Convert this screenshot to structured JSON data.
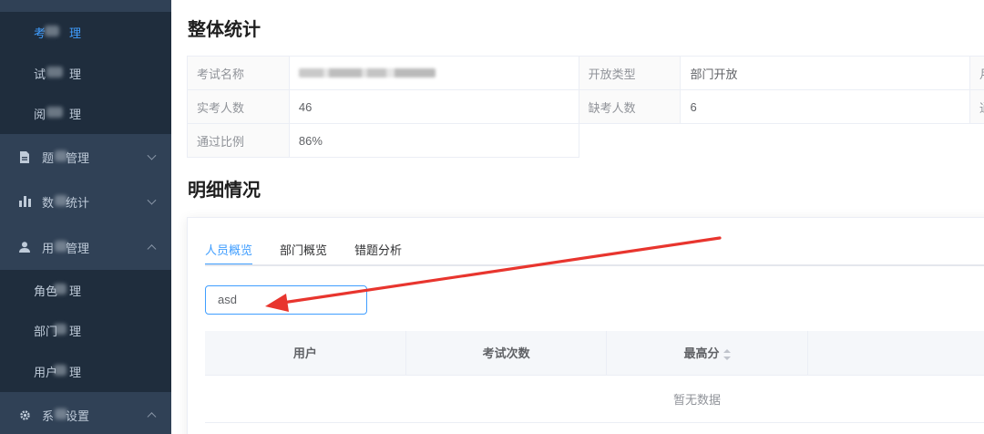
{
  "sidebar": {
    "items": [
      {
        "label_start": "考",
        "label_mid": "试",
        "label_end": "理",
        "kind": "sub",
        "active": true
      },
      {
        "label_start": "试",
        "label_mid": "卷管",
        "label_end": "理",
        "kind": "sub",
        "active": false
      },
      {
        "label_start": "阅",
        "label_mid": "卷管",
        "label_end": "理",
        "kind": "sub",
        "active": false
      },
      {
        "label_start": "题",
        "label_mid": "",
        "label_end": "管理",
        "kind": "menu",
        "icon": "document-icon",
        "arrow": "down"
      },
      {
        "label_start": "数",
        "label_mid": "",
        "label_end": "统计",
        "kind": "menu",
        "icon": "bar-chart-icon",
        "arrow": "down"
      },
      {
        "label_start": "用",
        "label_mid": "",
        "label_end": "管理",
        "kind": "menu",
        "icon": "user-icon",
        "arrow": "up"
      },
      {
        "label_start": "角色",
        "label_mid": "",
        "label_end": "理",
        "kind": "sub",
        "active": false
      },
      {
        "label_start": "部门",
        "label_mid": "",
        "label_end": "理",
        "kind": "sub",
        "active": false
      },
      {
        "label_start": "用户",
        "label_mid": "",
        "label_end": "理",
        "kind": "sub",
        "active": false
      },
      {
        "label_start": "系",
        "label_mid": "",
        "label_end": "设置",
        "kind": "menu",
        "icon": "gear-icon",
        "arrow": "up"
      }
    ]
  },
  "overall": {
    "title": "整体统计",
    "rows": [
      {
        "label1": "考试名称",
        "value1": "",
        "label2": "开放类型",
        "value2": "部门开放",
        "label3": "月"
      },
      {
        "label1": "实考人数",
        "value1": "46",
        "label2": "缺考人数",
        "value2": "6",
        "label3": "通"
      },
      {
        "label1": "通过比例",
        "value1": "86%"
      }
    ]
  },
  "detail": {
    "title": "明细情况",
    "tabs": [
      "人员概览",
      "部门概览",
      "错题分析"
    ],
    "active_tab": 0,
    "search_value": "asd",
    "table_headers": [
      "用户",
      "考试次数",
      "最高分"
    ],
    "empty_text": "暂无数据"
  },
  "colors": {
    "accent": "#409eff",
    "sidebar_bg": "#304156",
    "submenu_bg": "#1f2d3d",
    "annotation_arrow": "#e8352e"
  }
}
